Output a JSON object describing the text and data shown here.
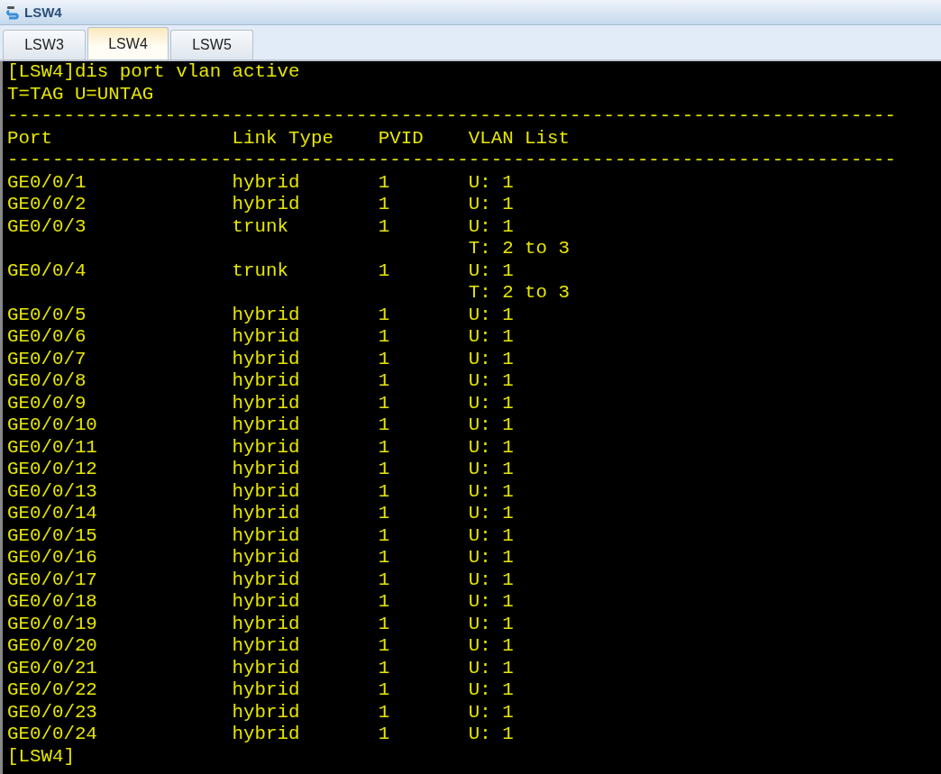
{
  "window": {
    "title": "LSW4"
  },
  "tabs": [
    {
      "label": "LSW3",
      "selected": false
    },
    {
      "label": "LSW4",
      "selected": true
    },
    {
      "label": "LSW5",
      "selected": false
    }
  ],
  "terminal": {
    "lines": [
      "[LSW4]dis port vlan active",
      "T=TAG U=UNTAG",
      "-------------------------------------------------------------------------------",
      "Port                Link Type    PVID    VLAN List",
      "-------------------------------------------------------------------------------",
      "GE0/0/1             hybrid       1       U: 1",
      "GE0/0/2             hybrid       1       U: 1",
      "GE0/0/3             trunk        1       U: 1",
      "                                         T: 2 to 3",
      "GE0/0/4             trunk        1       U: 1",
      "                                         T: 2 to 3",
      "GE0/0/5             hybrid       1       U: 1",
      "GE0/0/6             hybrid       1       U: 1",
      "GE0/0/7             hybrid       1       U: 1",
      "GE0/0/8             hybrid       1       U: 1",
      "GE0/0/9             hybrid       1       U: 1",
      "GE0/0/10            hybrid       1       U: 1",
      "GE0/0/11            hybrid       1       U: 1",
      "GE0/0/12            hybrid       1       U: 1",
      "GE0/0/13            hybrid       1       U: 1",
      "GE0/0/14            hybrid       1       U: 1",
      "GE0/0/15            hybrid       1       U: 1",
      "GE0/0/16            hybrid       1       U: 1",
      "GE0/0/17            hybrid       1       U: 1",
      "GE0/0/18            hybrid       1       U: 1",
      "GE0/0/19            hybrid       1       U: 1",
      "GE0/0/20            hybrid       1       U: 1",
      "GE0/0/21            hybrid       1       U: 1",
      "GE0/0/22            hybrid       1       U: 1",
      "GE0/0/23            hybrid       1       U: 1",
      "GE0/0/24            hybrid       1       U: 1",
      "[LSW4]"
    ]
  }
}
